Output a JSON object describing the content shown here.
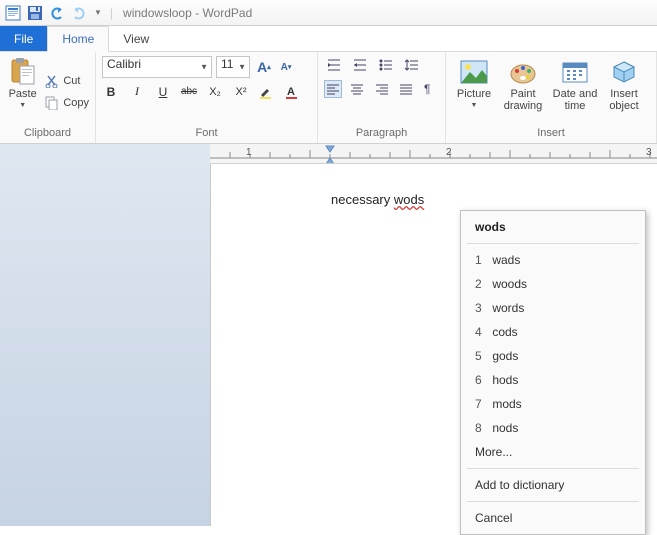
{
  "titlebar": {
    "document_name": "windowsloop",
    "app_name": "WordPad",
    "sep": " - "
  },
  "tabs": {
    "file": "File",
    "home": "Home",
    "view": "View"
  },
  "clipboard": {
    "paste": "Paste",
    "cut": "Cut",
    "copy": "Copy",
    "group_label": "Clipboard"
  },
  "font": {
    "family": "Calibri",
    "size": "11",
    "grow_label": "A",
    "shrink_label": "A",
    "bold": "B",
    "italic": "I",
    "underline": "U",
    "strike": "abc",
    "sub": "X₂",
    "sup": "X²",
    "group_label": "Font"
  },
  "paragraph": {
    "group_label": "Paragraph"
  },
  "insert": {
    "picture": "Picture",
    "paint": "Paint drawing",
    "datetime": "Date and time",
    "object": "Insert object",
    "group_label": "Insert"
  },
  "ruler": {
    "marks": [
      "1",
      "2",
      "3"
    ]
  },
  "document": {
    "word_ok": "necessary ",
    "word_err": "wods"
  },
  "context_menu": {
    "head": "wods",
    "suggestions": [
      {
        "n": "1",
        "w": "wads"
      },
      {
        "n": "2",
        "w": "woods"
      },
      {
        "n": "3",
        "w": "words"
      },
      {
        "n": "4",
        "w": "cods"
      },
      {
        "n": "5",
        "w": "gods"
      },
      {
        "n": "6",
        "w": "hods"
      },
      {
        "n": "7",
        "w": "mods"
      },
      {
        "n": "8",
        "w": "nods"
      }
    ],
    "more": "More...",
    "add": "Add to dictionary",
    "cancel": "Cancel"
  }
}
